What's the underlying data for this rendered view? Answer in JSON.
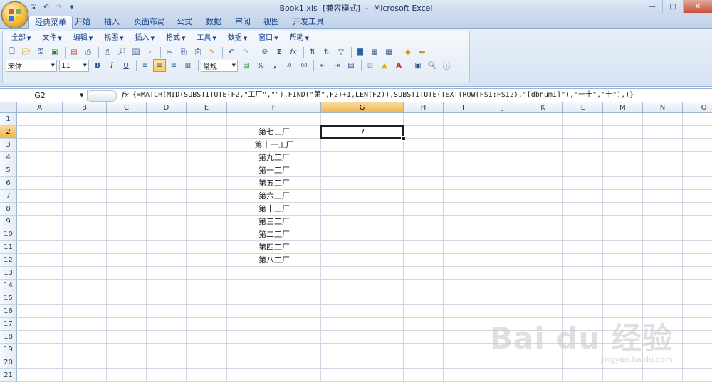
{
  "window": {
    "file_name": "Book1.xls",
    "mode": "[兼容模式]",
    "separator": "-",
    "app_name": "Microsoft Excel"
  },
  "tabs": [
    "经典菜单",
    "开始",
    "插入",
    "页面布局",
    "公式",
    "数据",
    "审阅",
    "视图",
    "开发工具"
  ],
  "active_tab": "经典菜单",
  "classic_menu": [
    "全部",
    "文件",
    "编辑",
    "视图",
    "插入",
    "格式",
    "工具",
    "数据",
    "窗口",
    "帮助"
  ],
  "format_bar": {
    "font_name": "宋体",
    "font_size": "11",
    "bold": "B",
    "italic": "I",
    "underline": "U",
    "number_format": "常规",
    "percent": "%",
    "comma": ","
  },
  "formula_bar": {
    "name_box": "G2",
    "fx": "fx",
    "formula": "{=MATCH(MID(SUBSTITUTE(F2,\"工厂\",\"\"),FIND(\"第\",F2)+1,LEN(F2)),SUBSTITUTE(TEXT(ROW(F$1:F$12),\"[dbnum1]\"),\"一十\",\"十\"),)}"
  },
  "columns": [
    "A",
    "B",
    "C",
    "D",
    "E",
    "F",
    "G",
    "H",
    "I",
    "J",
    "K",
    "L",
    "M",
    "N",
    "O"
  ],
  "selected_column": "G",
  "rows": [
    "1",
    "2",
    "3",
    "4",
    "5",
    "6",
    "7",
    "8",
    "9",
    "10",
    "11",
    "12",
    "13",
    "14",
    "15",
    "16",
    "17",
    "18",
    "19",
    "20",
    "21"
  ],
  "selected_row": "2",
  "cells": {
    "F": [
      "",
      "第七工厂",
      "第十一工厂",
      "第九工厂",
      "第一工厂",
      "第五工厂",
      "第六工厂",
      "第十工厂",
      "第三工厂",
      "第二工厂",
      "第四工厂",
      "第八工厂"
    ],
    "G2": "7"
  },
  "watermark": {
    "logo_text": "Bai du 经验",
    "url": "jingyan.baidu.com"
  },
  "colors": {
    "ribbon_text": "#15428b",
    "selected_header": "#f1b54d",
    "gridline": "#d0d7e5"
  }
}
